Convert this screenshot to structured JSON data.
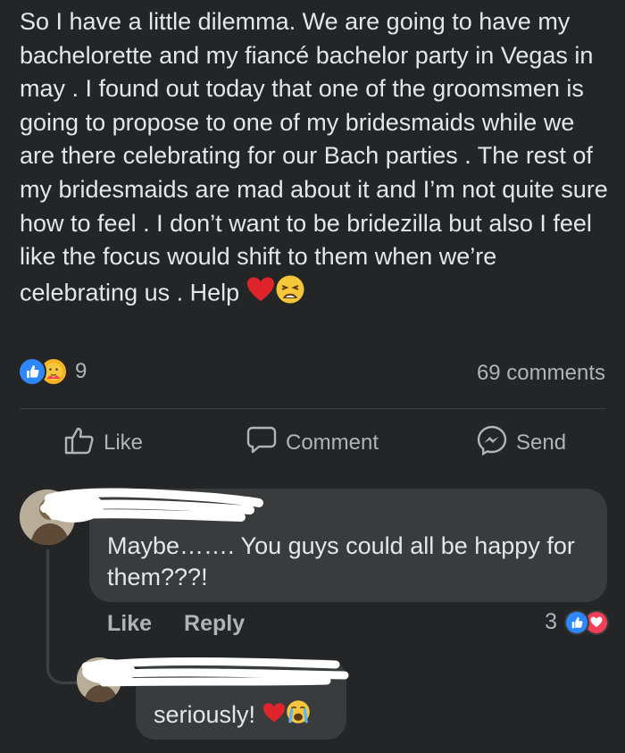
{
  "post": {
    "text": "So I have a little dilemma. We are going to have my bachelorette and my fiancé bachelor party in Vegas in may . I found out today that one of the groomsmen is going to propose to one of my bridesmaids while we are there celebrating for our Bach parties . The rest of my bridesmaids are mad about it and I’m not quite sure how to feel . I don’t want to be bridezilla but also I feel like the focus would shift to them when we’re celebrating us . Help",
    "emojis": [
      "red-heart",
      "weary-face"
    ],
    "reaction_icons": [
      "like-icon",
      "care-icon"
    ],
    "reaction_count": "9",
    "comments_count": "69 comments"
  },
  "actions": {
    "like": "Like",
    "comment": "Comment",
    "send": "Send"
  },
  "comment": {
    "author": "",
    "text": "Maybe……. You guys could all be happy for them???!",
    "like_label": "Like",
    "reply_label": "Reply",
    "reaction_count": "3",
    "reaction_icons": [
      "like-icon",
      "love-icon"
    ]
  },
  "reply": {
    "author": "",
    "text": "seriously!",
    "emojis": [
      "red-heart",
      "crying-face"
    ]
  },
  "colors": {
    "background": "#242526",
    "bubble": "#3a3b3c",
    "text": "#e4e6eb",
    "secondary_text": "#b0b3b8",
    "like_blue": "#2d88ff",
    "love_red": "#f33e58"
  }
}
